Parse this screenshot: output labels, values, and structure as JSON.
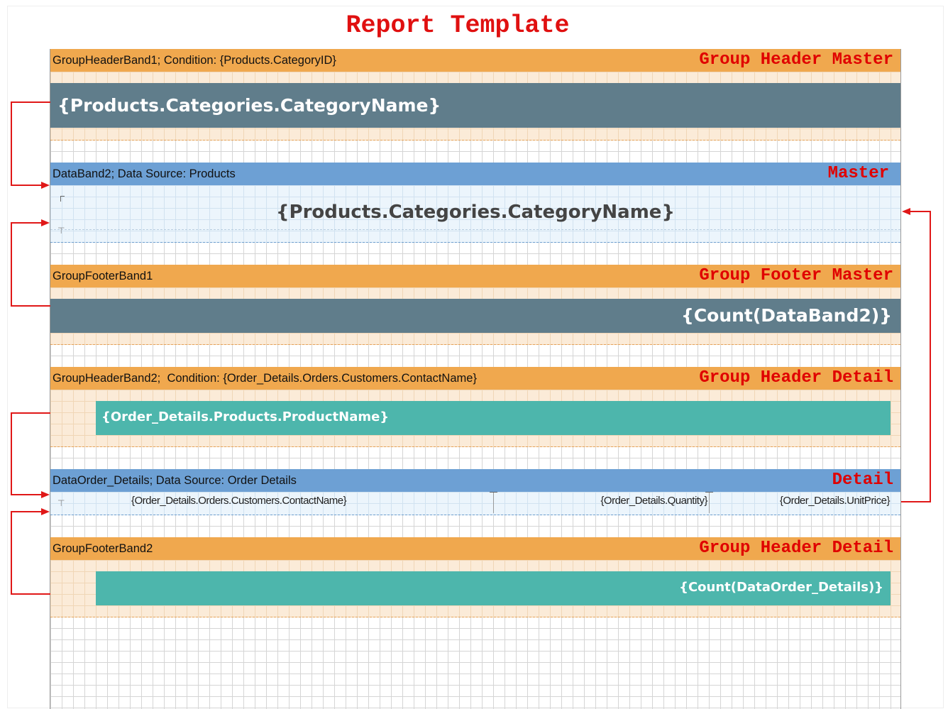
{
  "title": "Report Template",
  "bands": {
    "group_header_master": {
      "header": "GroupHeaderBand1; Condition: {Products.CategoryID}",
      "tag": "Group Header Master",
      "field": "{Products.Categories.CategoryName}"
    },
    "master": {
      "header": "DataBand2; Data Source: Products",
      "tag": "Master",
      "field": "{Products.Categories.CategoryName}"
    },
    "group_footer_master": {
      "header": "GroupFooterBand1",
      "tag": "Group Footer Master",
      "field": "{Count(DataBand2)}"
    },
    "group_header_detail": {
      "header": "GroupHeaderBand2;  Condition: {Order_Details.Orders.Customers.ContactName}",
      "tag": "Group Header Detail",
      "field": "{Order_Details.Products.ProductName}"
    },
    "detail": {
      "header": "DataOrder_Details; Data Source: Order Details",
      "tag": "Detail",
      "fields": {
        "contact": "{Order_Details.Orders.Customers.ContactName}",
        "quantity": "{Order_Details.Quantity}",
        "unit_price": "{Order_Details.UnitPrice}"
      }
    },
    "group_footer_detail": {
      "header": "GroupFooterBand2",
      "tag": "Group Header Detail",
      "field": "{Count(DataOrder_Details)}"
    }
  },
  "colors": {
    "band_header_orange": "#f0a84e",
    "band_header_blue": "#6da0d4",
    "field_slate": "#607d8b",
    "field_teal": "#4db6ac",
    "annotation_red": "#e00000"
  }
}
